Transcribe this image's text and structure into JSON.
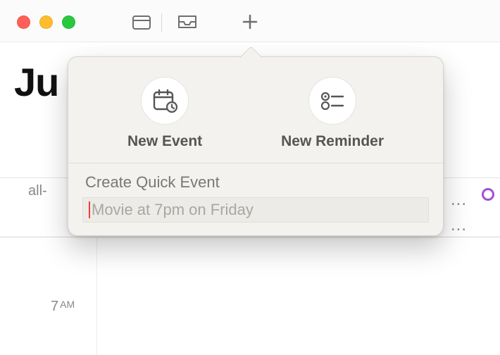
{
  "toolbar": {
    "buttons": {
      "calendars": "calendars",
      "inbox": "inbox",
      "add": "add"
    }
  },
  "background": {
    "month_fragment": "Ju",
    "allday_fragment": "all-",
    "time_7": "7",
    "time_7_ampm": "AM",
    "overflow_dots": "..."
  },
  "popover": {
    "new_event_label": "New Event",
    "new_reminder_label": "New Reminder",
    "quick_event_label": "Create Quick Event",
    "quick_event_placeholder": "Movie at 7pm on Friday"
  }
}
